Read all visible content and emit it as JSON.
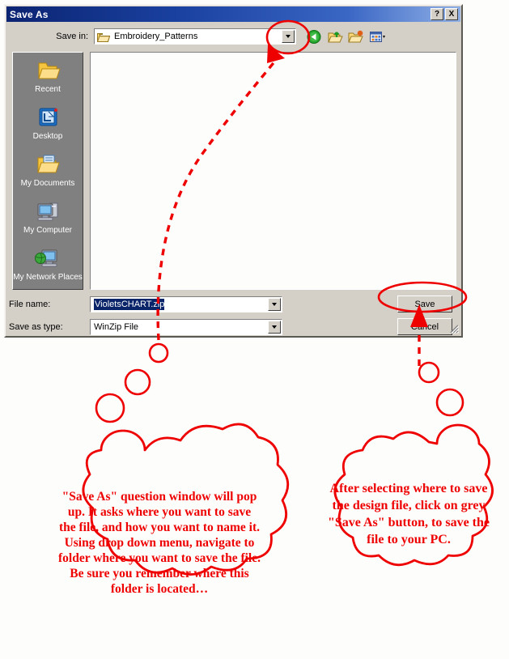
{
  "window": {
    "title": "Save As",
    "help_button": "?",
    "close_button": "X",
    "help_icon": "question-mark-icon",
    "close_icon": "close-x-icon"
  },
  "savein": {
    "label": "Save in:",
    "value": "Embroidery_Patterns",
    "folder_icon": "open-folder-icon",
    "dropdown_icon": "chevron-down-icon"
  },
  "toolbar": {
    "items": [
      {
        "name": "back-button",
        "icon": "back-arrow-icon"
      },
      {
        "name": "up-one-level-button",
        "icon": "up-folder-icon"
      },
      {
        "name": "create-new-folder-button",
        "icon": "new-folder-icon"
      },
      {
        "name": "views-button",
        "icon": "views-grid-icon"
      }
    ]
  },
  "places": {
    "items": [
      {
        "label": "Recent",
        "icon": "recent-folder-icon"
      },
      {
        "label": "Desktop",
        "icon": "desktop-icon"
      },
      {
        "label": "My Documents",
        "icon": "my-documents-icon"
      },
      {
        "label": "My Computer",
        "icon": "my-computer-icon"
      },
      {
        "label": "My Network Places",
        "icon": "network-places-icon"
      }
    ]
  },
  "filename": {
    "label": "File name:",
    "value": "VioletsCHART.zip",
    "dropdown_icon": "chevron-down-icon"
  },
  "filetype": {
    "label": "Save as type:",
    "value": "WinZip File",
    "dropdown_icon": "chevron-down-icon"
  },
  "buttons": {
    "save": "Save",
    "cancel": "Cancel"
  },
  "annotations": {
    "accent_color": "#ee0000",
    "left_bubble": "\"Save As\" question window will pop up. It asks where you want to save the file, and how you want to name it. Using drop down menu, navigate to folder where you want to save the file. Be sure you remember where this folder is located…",
    "right_bubble": "After selecting where to save the design file, click on grey \"Save As\" button, to save the file to your PC.",
    "highlight_dropdown": "red-ellipse-around-save-in-dropdown",
    "highlight_save_button": "red-ellipse-around-save-button",
    "pointer_to_dropdown": "red-dashed-arrow-icon",
    "pointer_to_save_button": "red-dashed-arrow-icon"
  }
}
